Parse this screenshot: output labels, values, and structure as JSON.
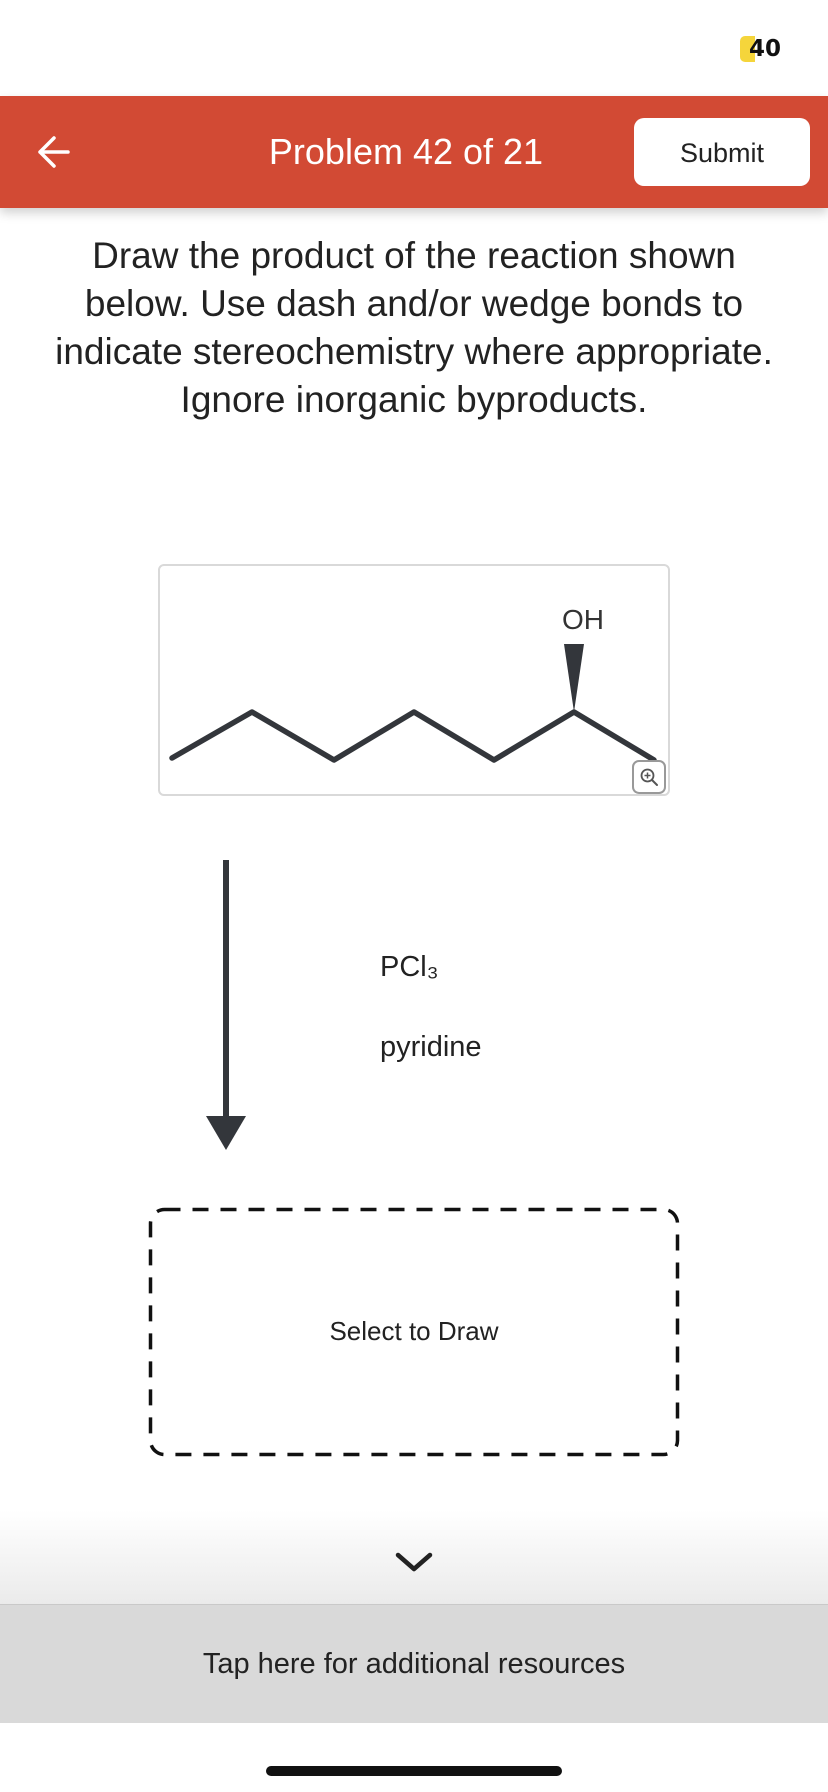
{
  "status_bar": {
    "badge_count": "40",
    "badge_color": "#f5d53b"
  },
  "header": {
    "title": "Problem 42 of 21",
    "submit_label": "Submit",
    "back_icon": "arrow-left-icon",
    "background_color": "#d24a34"
  },
  "question": {
    "text": "Draw the product of the reaction shown below. Use dash and/or wedge bonds to indicate stereochemistry where appropriate. Ignore inorganic byproducts."
  },
  "molecule": {
    "substituent_label": "OH",
    "zoom_icon": "zoom-in-icon"
  },
  "reaction": {
    "arrow_icon": "down-arrow-icon",
    "reagent_1": "PCl₃",
    "reagent_2": "pyridine"
  },
  "answer_area": {
    "label": "Select to Draw"
  },
  "resources": {
    "chevron_icon": "chevron-down-icon",
    "label": "Tap here for additional resources"
  }
}
